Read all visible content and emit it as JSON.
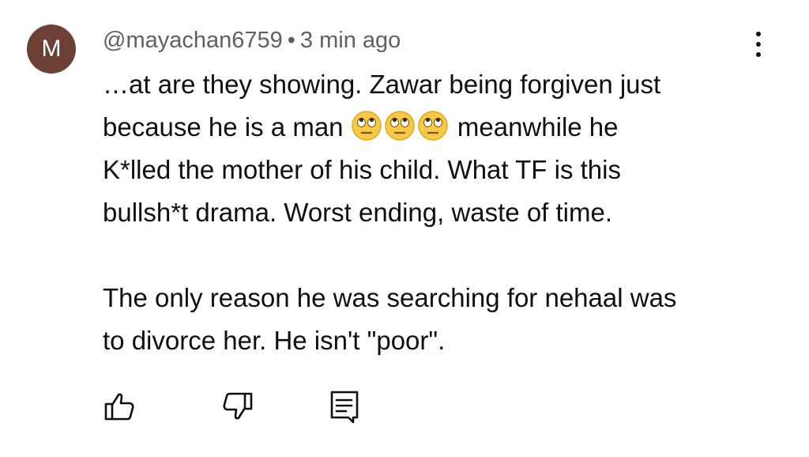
{
  "comment": {
    "avatar_letter": "M",
    "avatar_color": "#6d4036",
    "username": "@mayachan6759",
    "separator": "•",
    "time_ago": "3 min ago",
    "paragraph1": {
      "line1": "…at are they showing. Zawar being forgiven just",
      "line2_start": "because he is a man",
      "line2_end": "meanwhile he",
      "emojis": [
        "eye-roll-emoji",
        "eye-roll-emoji",
        "eye-roll-emoji"
      ],
      "line3": "K*lled the mother of his child. What TF is this",
      "line4": "bullsh*t drama.  Worst ending, waste of time."
    },
    "paragraph2": {
      "line1": "The only reason he was searching for nehaal was",
      "line2": "to divorce her. He isn't \"poor\"."
    }
  },
  "actions": {
    "like_icon": "thumb-up-icon",
    "dislike_icon": "thumb-down-icon",
    "reply_icon": "reply-comment-icon"
  },
  "menu_icon": "more-vertical-icon"
}
